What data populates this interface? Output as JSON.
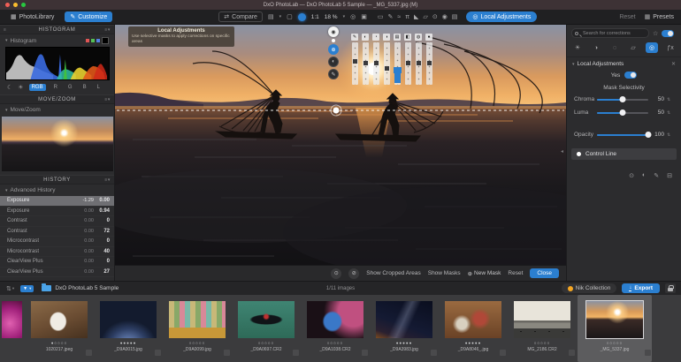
{
  "window": {
    "title": "DxO PhotoLab — DxO PhotoLab 5 Sample — _MG_5337.jpg (M)"
  },
  "colors": {
    "accent": "#2b7fd0",
    "selection": "#6f6f73",
    "histogram_r": "#e05555",
    "histogram_g": "#55c055",
    "histogram_b": "#5580e0"
  },
  "topbar": {
    "photolibrary": "PhotoLibrary",
    "customize": "Customize",
    "compare": "Compare",
    "zoom": {
      "one_to_one": "1:1",
      "value": "18 %"
    },
    "local_adjustments": "Local Adjustments",
    "reset": "Reset",
    "presets": "Presets",
    "icons": {
      "photolib_glyph": "▦",
      "customize_glyph": "✎",
      "compare_glyph": "⇄",
      "view_glyph": "▤",
      "frame_glyph": "▢",
      "caret": "▾",
      "target_glyph": "◎",
      "trash_glyph": "▣",
      "presets_glyph": "▦"
    },
    "tools": [
      {
        "name": "crop-tool-icon",
        "glyph": "▭"
      },
      {
        "name": "spot-removal-tool-icon",
        "glyph": "✎"
      },
      {
        "name": "horizon-tool-icon",
        "glyph": "≈"
      },
      {
        "name": "perspective-tool-icon",
        "glyph": "π"
      },
      {
        "name": "viewpoint-tool-icon",
        "glyph": "◣"
      },
      {
        "name": "shape-tool-icon",
        "glyph": "▱"
      },
      {
        "name": "mask-tool-icon",
        "glyph": "⊙"
      },
      {
        "name": "pick-tool-icon",
        "glyph": "◉"
      },
      {
        "name": "palette-tool-icon",
        "glyph": "▤"
      }
    ]
  },
  "left": {
    "histogram": {
      "header": "HISTOGRAM",
      "title": "Histogram",
      "moon_glyph": "☾",
      "sun_glyph": "☀",
      "channels": [
        {
          "label": "RGB",
          "state": "active"
        },
        {
          "label": "R",
          "state": ""
        },
        {
          "label": "G",
          "state": ""
        },
        {
          "label": "B",
          "state": ""
        },
        {
          "label": "L",
          "state": ""
        }
      ]
    },
    "movezoom": {
      "header": "MOVE/ZOOM",
      "title": "Move/Zoom"
    },
    "history": {
      "header": "HISTORY",
      "subheader": "Advanced History",
      "items": [
        {
          "label": "Exposure",
          "val1": "-1.29",
          "val2": "0.00",
          "state": "selected"
        },
        {
          "label": "Exposure",
          "val1": "0.00",
          "val2": "0.94",
          "state": ""
        },
        {
          "label": "Contrast",
          "val1": "0.00",
          "val2": "0",
          "state": ""
        },
        {
          "label": "Contrast",
          "val1": "0.00",
          "val2": "72",
          "state": ""
        },
        {
          "label": "Microcontrast",
          "val1": "0.00",
          "val2": "0",
          "state": ""
        },
        {
          "label": "Microcontrast",
          "val1": "0.00",
          "val2": "40",
          "state": ""
        },
        {
          "label": "ClearView Plus",
          "val1": "0.00",
          "val2": "0",
          "state": ""
        },
        {
          "label": "ClearView Plus",
          "val1": "0.00",
          "val2": "27",
          "state": ""
        }
      ]
    }
  },
  "canvas": {
    "tooltip": {
      "title": "Local Adjustments",
      "text": "Use selective masks to apply corrections on specific areas"
    },
    "equalizer": {
      "buttons": [
        {
          "name": "mask-target-button",
          "glyph": "◉",
          "state": "white"
        },
        {
          "name": "pin-dot",
          "glyph": "",
          "state": "dot"
        },
        {
          "name": "add-mask-button",
          "glyph": "⊕",
          "state": "blue"
        },
        {
          "name": "invert-mask-button",
          "glyph": "◐",
          "state": "dark"
        },
        {
          "name": "mask-options-button",
          "glyph": "✎",
          "state": "dark"
        }
      ],
      "sliders": [
        {
          "name": "exposure",
          "glyph": "✎",
          "pos": 40,
          "state": ""
        },
        {
          "name": "contrast",
          "glyph": "◐",
          "pos": 44,
          "state": ""
        },
        {
          "name": "vibrancy",
          "glyph": "◔",
          "pos": 44,
          "state": ""
        },
        {
          "name": "saturation",
          "glyph": "◑",
          "pos": 56,
          "state": ""
        },
        {
          "name": "temperature",
          "glyph": "▤",
          "pos": 58,
          "state": "active"
        },
        {
          "name": "tint",
          "glyph": "◧",
          "pos": 44,
          "state": ""
        },
        {
          "name": "blur",
          "glyph": "◍",
          "pos": 44,
          "state": ""
        },
        {
          "name": "sharpness",
          "glyph": "●",
          "pos": 44,
          "state": ""
        }
      ]
    },
    "footer": {
      "eye1_glyph": "⊙",
      "eye2_glyph": "⊘",
      "show_cropped": "Show Cropped Areas",
      "show_masks": "Show Masks",
      "new_mask_glyph": "⊕",
      "new_mask": "New Mask",
      "reset": "Reset",
      "close": "Close"
    }
  },
  "right": {
    "search_placeholder": "Search for corrections",
    "favorite_glyph": "☆",
    "tabs": [
      {
        "name": "tab-light",
        "glyph": "☀",
        "state": ""
      },
      {
        "name": "tab-color",
        "glyph": "◑",
        "state": ""
      },
      {
        "name": "tab-detail",
        "glyph": "◌",
        "state": ""
      },
      {
        "name": "tab-geometry",
        "glyph": "▱",
        "state": ""
      },
      {
        "name": "tab-local-adjustments",
        "glyph": "◎",
        "state": "active"
      },
      {
        "name": "tab-effects",
        "glyph": "ƒx",
        "state": ""
      }
    ],
    "section": "Local Adjustments",
    "yes": "Yes",
    "mask_selectivity": "Mask Selectivity",
    "sliders": [
      {
        "label": "Chroma",
        "value": "50",
        "pct": 50,
        "state": ""
      },
      {
        "label": "Luma",
        "value": "50",
        "pct": 50,
        "state": ""
      },
      {
        "label": "Opacity",
        "value": "100",
        "pct": 100,
        "state": "gap"
      }
    ],
    "control_line": "Control Line",
    "mask_icons": [
      {
        "name": "eye-icon",
        "glyph": "⊙"
      },
      {
        "name": "invert-icon",
        "glyph": "◐"
      },
      {
        "name": "edit-icon",
        "glyph": "✎"
      },
      {
        "name": "delete-icon",
        "glyph": "⊟"
      }
    ]
  },
  "statusbar": {
    "sort_glyph": "⇅",
    "filter_glyph": "▼",
    "caret": "▾",
    "folder": "DxO PhotoLab 5 Sample",
    "count": "1/11 images",
    "nik": "Nik Collection",
    "export": "Export",
    "export_glyph": "↓"
  },
  "filmstrip": {
    "thumbs": [
      {
        "filename": "",
        "rating": "",
        "art": "art-pink",
        "state": "partial"
      },
      {
        "filename": "1020217.jpeg",
        "rating": "●○○○○",
        "art": "art-dog",
        "state": ""
      },
      {
        "filename": "_D9A0015.jpg",
        "rating": "●●●●●",
        "art": "art-arch",
        "state": ""
      },
      {
        "filename": "_D9A0099.jpg",
        "rating": "○○○○○",
        "art": "art-facade",
        "state": ""
      },
      {
        "filename": "_D9A0697.CR2",
        "rating": "○○○○○",
        "art": "art-boat",
        "state": ""
      },
      {
        "filename": "_D9A1038.CR2",
        "rating": "○○○○○",
        "art": "art-face",
        "state": ""
      },
      {
        "filename": "_D9A3983.jpg",
        "rating": "●●●●●",
        "art": "art-milkyway",
        "state": ""
      },
      {
        "filename": "_D9A8046_.jpg",
        "rating": "●●●●●",
        "art": "art-cattle",
        "state": ""
      },
      {
        "filename": "MG_2186.CR2",
        "rating": "○○○○○",
        "art": "art-beach",
        "state": ""
      },
      {
        "filename": "_MG_5337.jpg",
        "rating": "○○○○○",
        "art": "art-sunset",
        "state": "selected"
      }
    ]
  }
}
